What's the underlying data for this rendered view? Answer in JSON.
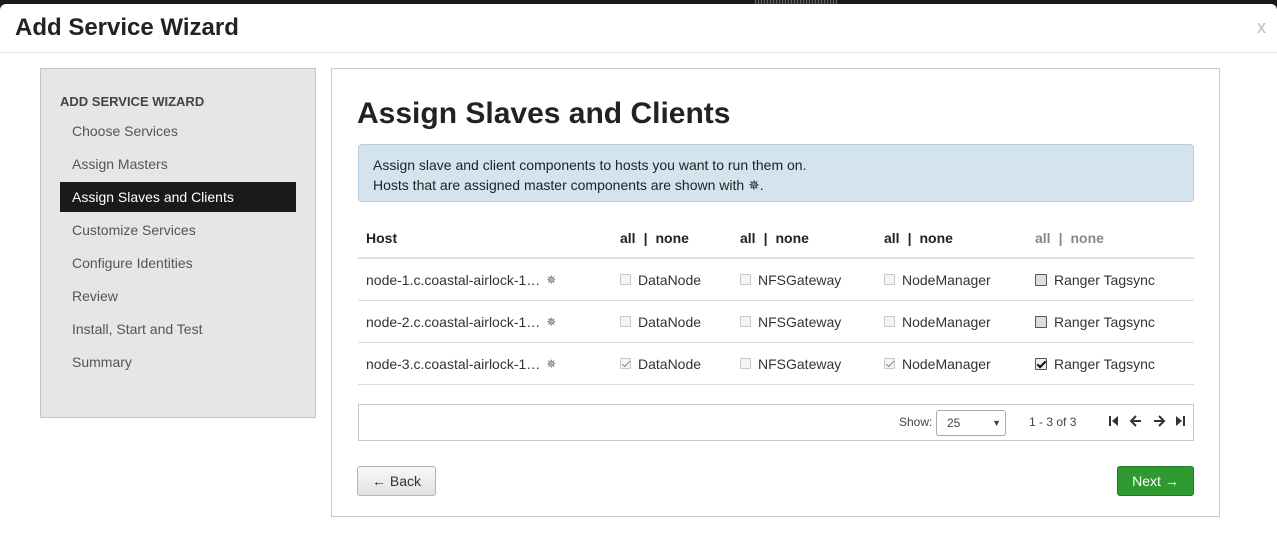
{
  "modal": {
    "title": "Add Service Wizard",
    "close_label": "x"
  },
  "sidebar": {
    "header": "ADD SERVICE WIZARD",
    "steps": [
      {
        "label": "Choose Services",
        "active": false
      },
      {
        "label": "Assign Masters",
        "active": false
      },
      {
        "label": "Assign Slaves and Clients",
        "active": true
      },
      {
        "label": "Customize Services",
        "active": false
      },
      {
        "label": "Configure Identities",
        "active": false
      },
      {
        "label": "Review",
        "active": false
      },
      {
        "label": "Install, Start and Test",
        "active": false
      },
      {
        "label": "Summary",
        "active": false
      }
    ]
  },
  "main": {
    "title": "Assign Slaves and Clients",
    "alert": {
      "line1": "Assign slave and client components to hosts you want to run them on.",
      "line2": "Hosts that are assigned master components are shown with ✵."
    },
    "grid": {
      "host_header": "Host",
      "all_label": "all",
      "separator": "|",
      "none_label": "none",
      "components": [
        "DataNode",
        "NFSGateway",
        "NodeManager",
        "Ranger Tagsync"
      ],
      "rows": [
        {
          "host": "node-1.c.coastal-airlock-1…",
          "checked": [
            false,
            false,
            false,
            false
          ]
        },
        {
          "host": "node-2.c.coastal-airlock-1…",
          "checked": [
            false,
            false,
            false,
            false
          ]
        },
        {
          "host": "node-3.c.coastal-airlock-1…",
          "checked": [
            true,
            false,
            true,
            true
          ]
        }
      ],
      "master_icon": "gear-icon",
      "master_glyph": "✵"
    },
    "pager": {
      "show_label": "Show:",
      "page_size": "25",
      "range_text": "1 - 3 of 3"
    },
    "buttons": {
      "back_label": "← Back",
      "next_label": "Next →"
    }
  },
  "colors": {
    "next_button": "#2f9a2f",
    "alert_bg": "#d4e4ef",
    "active_step_bg": "#1a1a1a"
  }
}
